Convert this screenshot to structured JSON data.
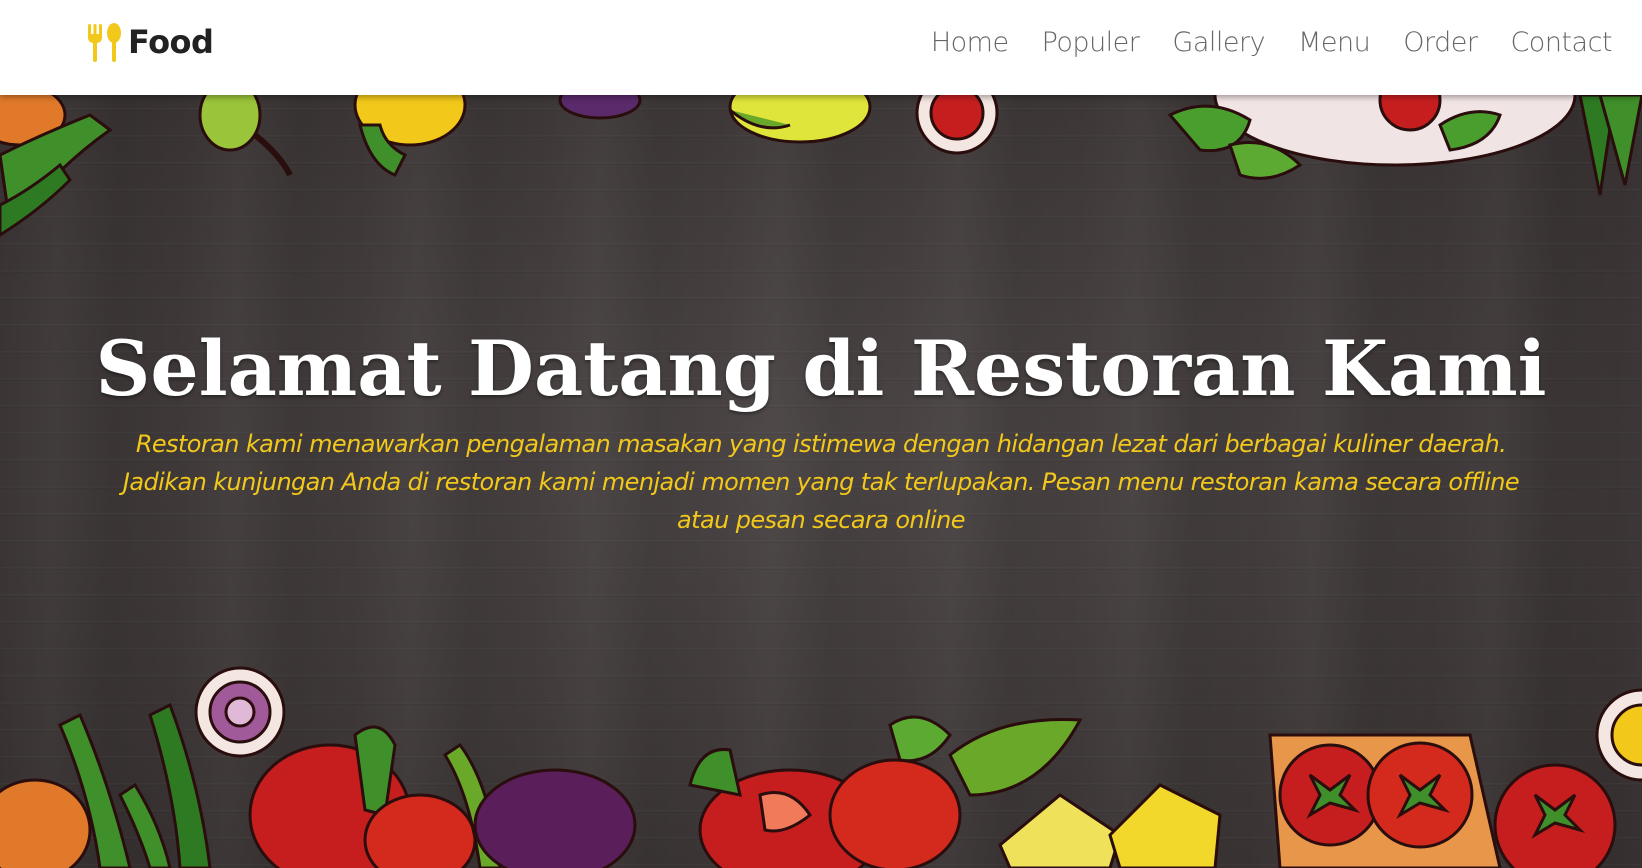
{
  "nav": {
    "brand": "Food",
    "links": [
      "Home",
      "Populer",
      "Gallery",
      "Menu",
      "Order",
      "Contact"
    ]
  },
  "hero": {
    "title": "Selamat Datang di Restoran Kami",
    "description": "Restoran kami menawarkan pengalaman masakan yang istimewa dengan hidangan lezat dari berbagai kuliner daerah. Jadikan kunjungan Anda di restoran kami menjadi momen yang tak terlupakan. Pesan menu restoran kama secara offline atau pesan secara online"
  },
  "icons": {
    "brand": "fork-spoon-icon"
  },
  "colors": {
    "accent": "#f2c81a",
    "navbar_bg": "#ffffff",
    "hero_bg": "#3e3838",
    "title": "#ffffff",
    "nav_text": "#666666"
  }
}
